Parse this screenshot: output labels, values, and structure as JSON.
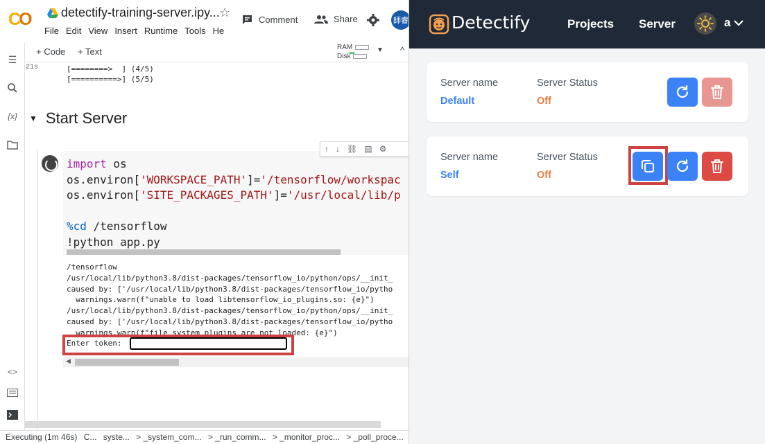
{
  "colab": {
    "logo": "CO",
    "notebook_title": "detectify-training-server.ipy...",
    "menu": [
      "File",
      "Edit",
      "View",
      "Insert",
      "Runtime",
      "Tools",
      "He"
    ],
    "comment_label": "Comment",
    "share_label": "Share",
    "avatar_text": "師睿",
    "toolbar": {
      "code_label": "+ Code",
      "text_label": "+ Text",
      "ram_label": "RAM",
      "disk_label": "Disk"
    },
    "exec_time": "21s",
    "progress_lines": "[========>  ] (4/5)\n[==========>] (5/5)",
    "section_title": "Start Server",
    "output_lines": "/tensorflow\n/usr/local/lib/python3.8/dist-packages/tensorflow_io/python/ops/__init_\ncaused by: ['/usr/local/lib/python3.8/dist-packages/tensorflow_io/pytho\n  warnings.warn(f\"unable to load libtensorflow_io_plugins.so: {e}\")\n/usr/local/lib/python3.8/dist-packages/tensorflow_io/python/ops/__init_\ncaused by: ['/usr/local/lib/python3.8/dist-packages/tensorflow_io/pytho\n  warnings.warn(f\"file_system_plugins are not loaded: {e}\")",
    "token_prompt": "Enter token:",
    "status_items": [
      "Executing (1m 46s)",
      "C...",
      "syste...",
      "> _system_com...",
      "> _run_comm...",
      "> _monitor_proc...",
      "> _poll_proce..."
    ]
  },
  "detectify": {
    "brand": "Detectify",
    "nav": {
      "projects": "Projects",
      "server": "Server",
      "user": "a"
    },
    "servers": [
      {
        "name_label": "Server name",
        "name": "Default",
        "status_label": "Server Status",
        "status": "Off",
        "has_copy": false,
        "delete_disabled": true
      },
      {
        "name_label": "Server name",
        "name": "Self",
        "status_label": "Server Status",
        "status": "Off",
        "has_copy": true,
        "delete_disabled": false
      }
    ],
    "colors": {
      "nav_bg": "#1f2937",
      "primary": "#3b82f6",
      "danger": "#dc4a43",
      "status_off": "#ea7b3e",
      "accent_orange": "#f59e4f",
      "annotation_red": "#cd4343"
    }
  }
}
